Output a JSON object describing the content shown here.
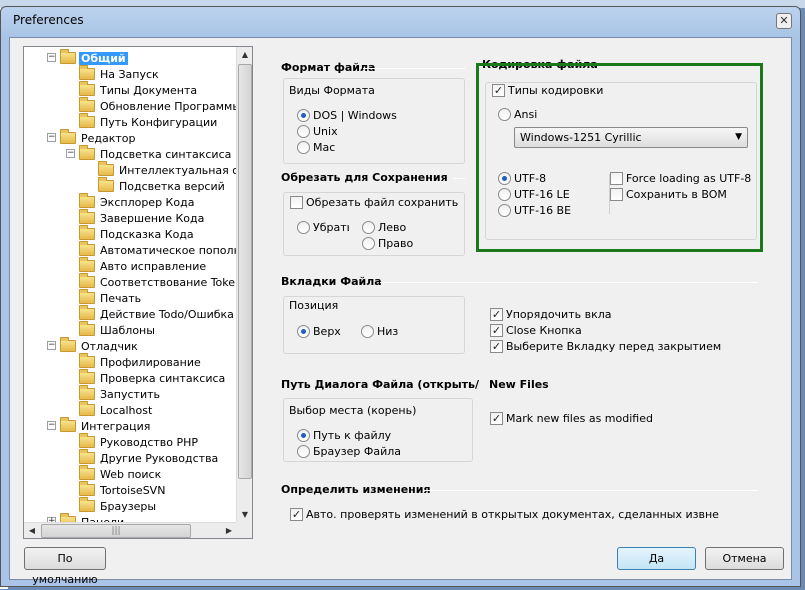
{
  "window": {
    "title": "Preferences",
    "close_glyph": "✕"
  },
  "tree": {
    "nodes": [
      {
        "label": "Общий",
        "twisty": "−"
      },
      {
        "label": "На Запуск"
      },
      {
        "label": "Типы Документа"
      },
      {
        "label": "Обновление Программы"
      },
      {
        "label": "Путь Конфигурации"
      },
      {
        "label": "Редактор",
        "twisty": "−"
      },
      {
        "label": "Подсветка синтаксиса",
        "twisty": "−"
      },
      {
        "label": "Интеллектуальная остан"
      },
      {
        "label": "Подсветка версий"
      },
      {
        "label": "Эксплорер Кода"
      },
      {
        "label": "Завершение Кода"
      },
      {
        "label": "Подсказка Кода"
      },
      {
        "label": "Автоматическое пополнение"
      },
      {
        "label": "Авто исправление"
      },
      {
        "label": "Соответствование Tokens"
      },
      {
        "label": "Печать"
      },
      {
        "label": "Действие Todo/Ошибка"
      },
      {
        "label": "Шаблоны"
      },
      {
        "label": "Отладчик",
        "twisty": "−"
      },
      {
        "label": "Профилирование"
      },
      {
        "label": "Проверка синтаксиса"
      },
      {
        "label": "Запустить"
      },
      {
        "label": "Localhost"
      },
      {
        "label": "Интеграция",
        "twisty": "−"
      },
      {
        "label": "Руководство PHP"
      },
      {
        "label": "Другие Руководства"
      },
      {
        "label": "Web поиск"
      },
      {
        "label": "TortoiseSVN"
      },
      {
        "label": "Браузеры"
      },
      {
        "label": "Панели",
        "twisty": "+"
      }
    ],
    "scroll_up_glyph": "▲",
    "scroll_down_glyph": "▼",
    "scroll_left_glyph": "◀",
    "scroll_right_glyph": "▶",
    "grip_glyph": "|||"
  },
  "file_format": {
    "header": "Формат файла",
    "group_label": "Виды Формата",
    "options": [
      "DOS | Windows",
      "Unix",
      "Mac"
    ]
  },
  "trim": {
    "header": "Обрезать для Сохранения",
    "checkbox_label": "Обрезать файл сохранить",
    "options": [
      "Убрать",
      "Лево",
      "Право"
    ]
  },
  "encoding": {
    "header": "Кодировка файла",
    "types_checkbox": "Типы кодировки",
    "ansi": "Ansi",
    "selected_codepage": "Windows-1251 Cyrillic",
    "dropdown_glyph": "▼",
    "options": [
      "UTF-8",
      "UTF-16 LE",
      "UTF-16 BE"
    ],
    "force_utf8": "Force loading as UTF-8",
    "save_bom": "Сохранить в BOM"
  },
  "tabs": {
    "header": "Вкладки Файла",
    "position_label": "Позиция",
    "positions": [
      "Верх",
      "Низ"
    ],
    "checks": [
      "Упорядочить вкладк",
      "Close Кнопка",
      "Выберите Вкладку перед закрытием"
    ]
  },
  "dialog_path": {
    "header": "Путь Диалога Файла (открыть/",
    "group_label": "Выбор места (корень)",
    "options": [
      "Путь к файлу",
      "Браузер Файла"
    ]
  },
  "new_files": {
    "header": "New Files",
    "check": "Mark new files as modified"
  },
  "detect": {
    "header": "Определить изменения",
    "check": "Авто. проверять изменений в открытых документах, сделанных извне"
  },
  "buttons": {
    "defaults": "По умолчанию",
    "ok": "Да",
    "cancel": "Отмена"
  },
  "check_glyph": "✓"
}
